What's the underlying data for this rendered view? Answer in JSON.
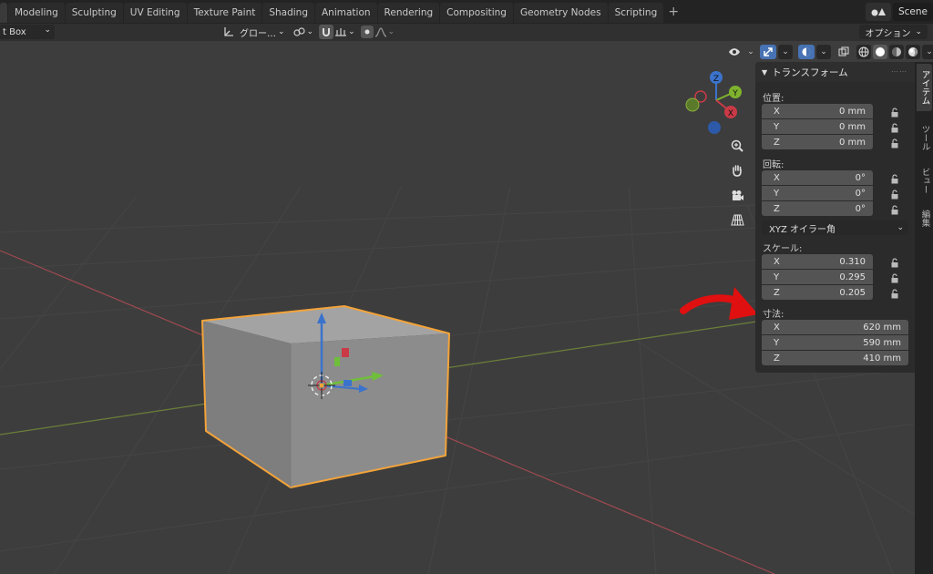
{
  "topbar": {
    "tabs": [
      "Modeling",
      "Sculpting",
      "UV Editing",
      "Texture Paint",
      "Shading",
      "Animation",
      "Rendering",
      "Compositing",
      "Geometry Nodes",
      "Scripting"
    ],
    "add_label": "+",
    "scene_label": "Scene"
  },
  "header": {
    "mode_select": "t Box",
    "transform_orientation": "グロー…",
    "options_label": "オプション"
  },
  "icons": {
    "transform-orientation": "axes-icon",
    "pivot": "link-icon",
    "snap": "magnet-icon",
    "proportional": "proportional-falloff-icon",
    "visibility": "eye-icon",
    "gizmo": "gizmo-arrow-icon",
    "overlay": "overlay-icon",
    "xray": "xray-icon",
    "shading": [
      "wireframe-icon",
      "solid-icon",
      "material-icon",
      "rendered-icon"
    ],
    "nav": [
      "zoom-icon",
      "hand-pan-icon",
      "camera-icon",
      "grid-perspective-icon"
    ],
    "lock": "lock-icon"
  },
  "npanel": {
    "title": "トランスフォーム",
    "location": {
      "label": "位置:",
      "rows": [
        {
          "axis": "X",
          "value": "0 mm"
        },
        {
          "axis": "Y",
          "value": "0 mm"
        },
        {
          "axis": "Z",
          "value": "0 mm"
        }
      ]
    },
    "rotation": {
      "label": "回転:",
      "rows": [
        {
          "axis": "X",
          "value": "0°"
        },
        {
          "axis": "Y",
          "value": "0°"
        },
        {
          "axis": "Z",
          "value": "0°"
        }
      ],
      "mode": "XYZ オイラー角"
    },
    "scale": {
      "label": "スケール:",
      "rows": [
        {
          "axis": "X",
          "value": "0.310"
        },
        {
          "axis": "Y",
          "value": "0.295"
        },
        {
          "axis": "Z",
          "value": "0.205"
        }
      ]
    },
    "dimensions": {
      "label": "寸法:",
      "rows": [
        {
          "axis": "X",
          "value": "620 mm"
        },
        {
          "axis": "Y",
          "value": "590 mm"
        },
        {
          "axis": "Z",
          "value": "410 mm"
        }
      ]
    }
  },
  "side_tabs": [
    "アイテム",
    "ツール",
    "ビュー",
    "編集"
  ],
  "gizmo_axes": {
    "x": "X",
    "y": "Y",
    "z": "Z"
  },
  "colors": {
    "accent": "#4772b3",
    "selection_outline": "#f2a33a",
    "annotation_arrow": "#e01010",
    "x_axis": "#c93a46",
    "y_axis": "#7fb32d",
    "z_axis": "#3b73cc"
  }
}
